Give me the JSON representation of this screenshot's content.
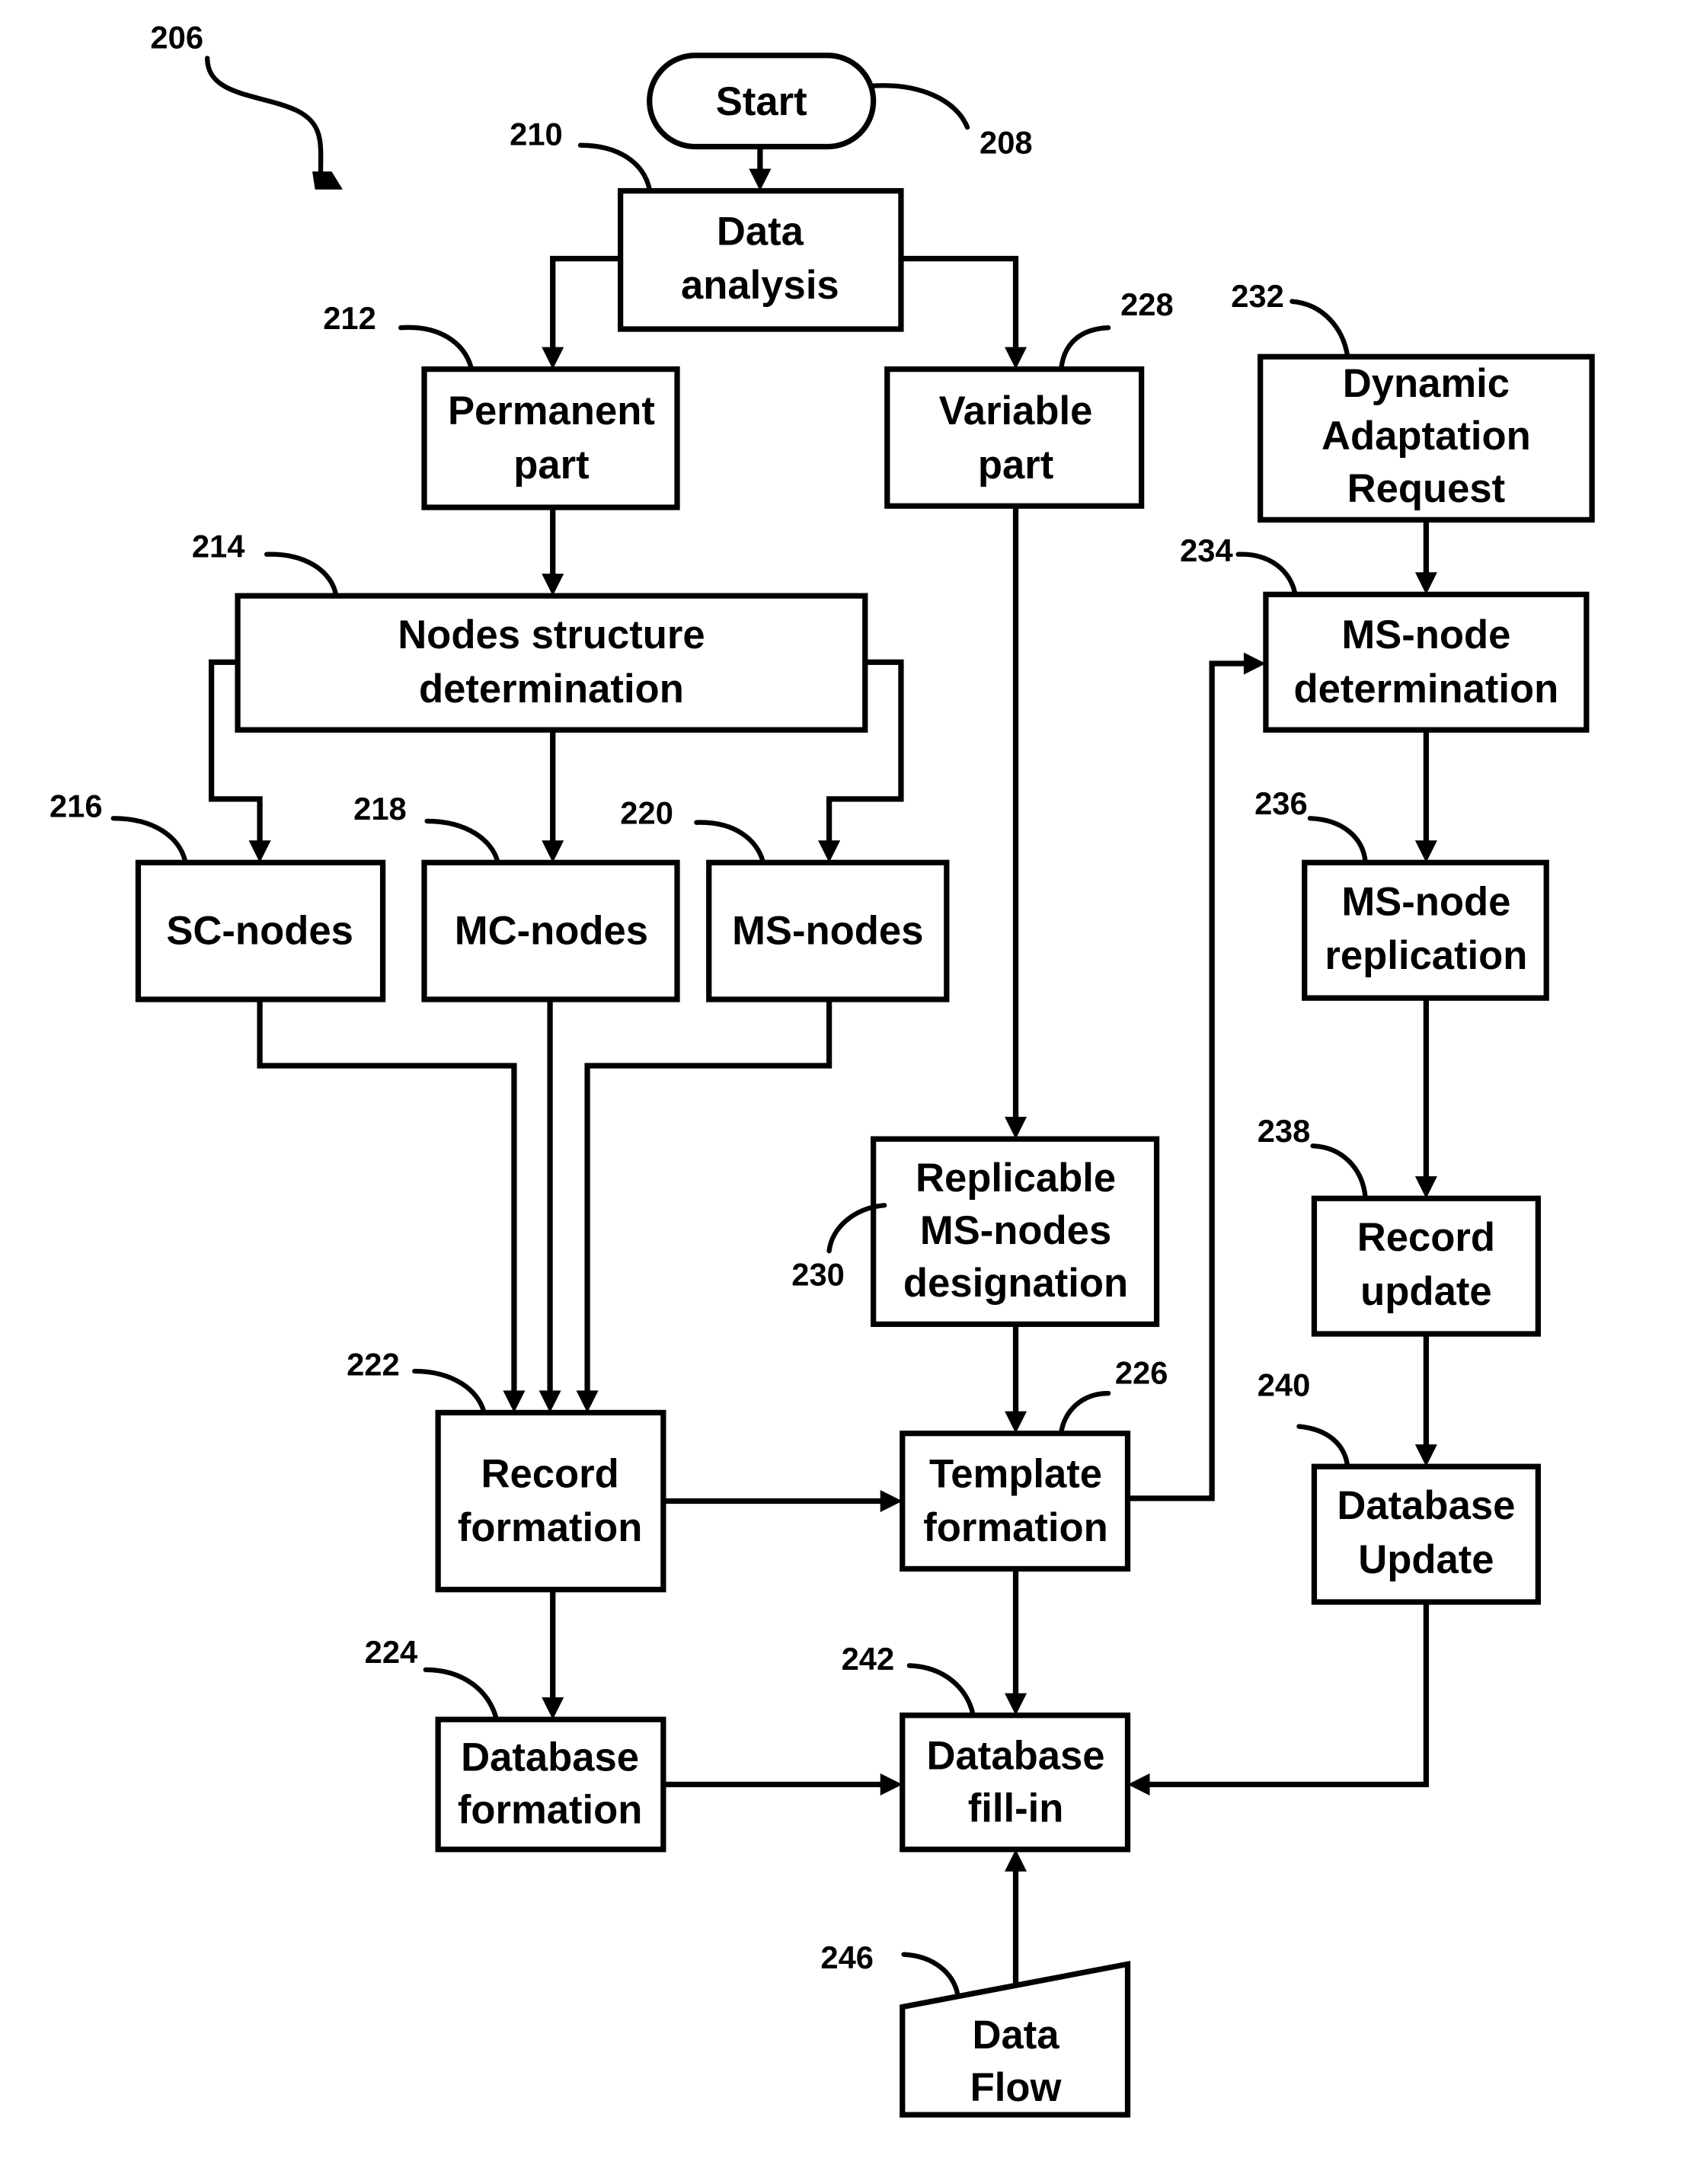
{
  "figure": {
    "ref": "206",
    "colors": {
      "stroke": "#000000",
      "background": "#ffffff"
    }
  },
  "nodes": {
    "start": {
      "ref": "208",
      "lines": [
        "Start"
      ]
    },
    "data_analysis": {
      "ref": "210",
      "lines": [
        "Data",
        "analysis"
      ]
    },
    "permanent_part": {
      "ref": "212",
      "lines": [
        "Permanent",
        "part"
      ]
    },
    "nodes_structure": {
      "ref": "214",
      "lines": [
        "Nodes structure",
        "determination"
      ]
    },
    "sc_nodes": {
      "ref": "216",
      "lines": [
        "SC-nodes"
      ]
    },
    "mc_nodes": {
      "ref": "218",
      "lines": [
        "MC-nodes"
      ]
    },
    "ms_nodes": {
      "ref": "220",
      "lines": [
        "MS-nodes"
      ]
    },
    "record_formation": {
      "ref": "222",
      "lines": [
        "Record",
        "formation"
      ]
    },
    "database_formation": {
      "ref": "224",
      "lines": [
        "Database",
        "formation"
      ]
    },
    "template_formation": {
      "ref": "226",
      "lines": [
        "Template",
        "formation"
      ]
    },
    "variable_part": {
      "ref": "228",
      "lines": [
        "Variable",
        "part"
      ]
    },
    "replicable_ms_nodes": {
      "ref": "230",
      "lines": [
        "Replicable",
        "MS-nodes",
        "designation"
      ]
    },
    "dynamic_adaptation_request": {
      "ref": "232",
      "lines": [
        "Dynamic",
        "Adaptation",
        "Request"
      ]
    },
    "ms_node_determination": {
      "ref": "234",
      "lines": [
        "MS-node",
        "determination"
      ]
    },
    "ms_node_replication": {
      "ref": "236",
      "lines": [
        "MS-node",
        "replication"
      ]
    },
    "record_update": {
      "ref": "238",
      "lines": [
        "Record",
        "update"
      ]
    },
    "database_update": {
      "ref": "240",
      "lines": [
        "Database",
        "Update"
      ]
    },
    "database_fill_in": {
      "ref": "242",
      "lines": [
        "Database",
        "fill-in"
      ]
    },
    "data_flow": {
      "ref": "246",
      "lines": [
        "Data",
        "Flow"
      ]
    }
  },
  "edges": [
    {
      "from": "start",
      "to": "data_analysis"
    },
    {
      "from": "data_analysis",
      "to": "permanent_part"
    },
    {
      "from": "data_analysis",
      "to": "variable_part"
    },
    {
      "from": "permanent_part",
      "to": "nodes_structure"
    },
    {
      "from": "nodes_structure",
      "to": "sc_nodes"
    },
    {
      "from": "nodes_structure",
      "to": "mc_nodes"
    },
    {
      "from": "nodes_structure",
      "to": "ms_nodes"
    },
    {
      "from": "sc_nodes",
      "to": "record_formation"
    },
    {
      "from": "mc_nodes",
      "to": "record_formation"
    },
    {
      "from": "ms_nodes",
      "to": "record_formation"
    },
    {
      "from": "variable_part",
      "to": "replicable_ms_nodes"
    },
    {
      "from": "replicable_ms_nodes",
      "to": "template_formation"
    },
    {
      "from": "record_formation",
      "to": "template_formation"
    },
    {
      "from": "record_formation",
      "to": "database_formation"
    },
    {
      "from": "template_formation",
      "to": "ms_node_determination"
    },
    {
      "from": "template_formation",
      "to": "database_fill_in"
    },
    {
      "from": "dynamic_adaptation_request",
      "to": "ms_node_determination"
    },
    {
      "from": "ms_node_determination",
      "to": "ms_node_replication"
    },
    {
      "from": "ms_node_replication",
      "to": "record_update"
    },
    {
      "from": "record_update",
      "to": "database_update"
    },
    {
      "from": "database_update",
      "to": "database_fill_in"
    },
    {
      "from": "database_formation",
      "to": "database_fill_in"
    },
    {
      "from": "data_flow",
      "to": "database_fill_in"
    }
  ]
}
